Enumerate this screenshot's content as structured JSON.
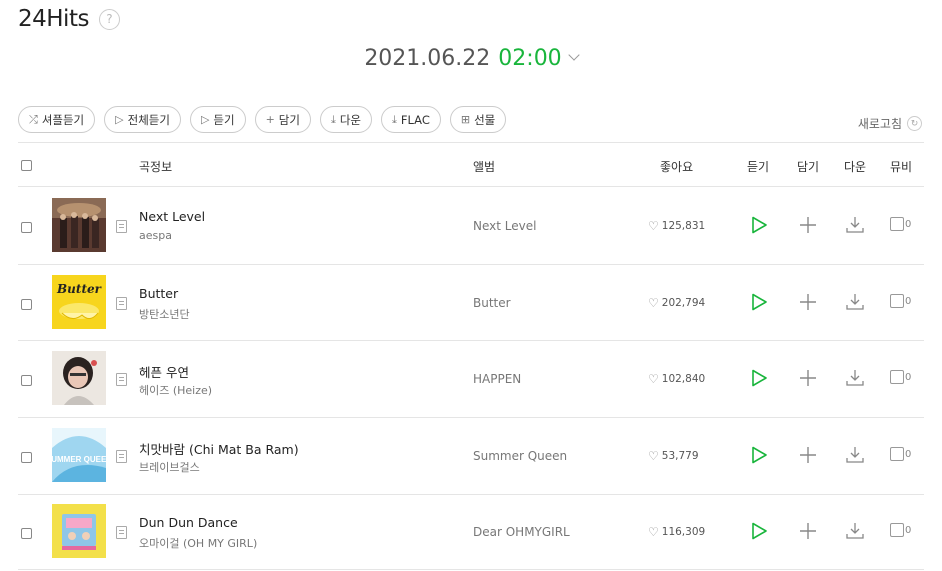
{
  "header": {
    "title": "24Hits",
    "help_label": "?"
  },
  "datetime": {
    "date": "2021.06.22",
    "time": "02:00"
  },
  "toolbar": {
    "buttons": [
      {
        "icon": "shuffle-icon",
        "glyph": "⤮",
        "label": "셔플듣기"
      },
      {
        "icon": "play-icon",
        "glyph": "▷",
        "label": "전체듣기"
      },
      {
        "icon": "play-icon",
        "glyph": "▷",
        "label": "듣기"
      },
      {
        "icon": "plus-icon",
        "glyph": "+",
        "label": "담기"
      },
      {
        "icon": "download-icon",
        "glyph": "⤓",
        "label": "다운"
      },
      {
        "icon": "download-icon",
        "glyph": "⤓",
        "label": "FLAC"
      },
      {
        "icon": "gift-icon",
        "glyph": "⊞",
        "label": "선물"
      }
    ]
  },
  "refresh": {
    "label": "새로고침"
  },
  "table": {
    "columns": {
      "song_info": "곡정보",
      "album": "앨범",
      "likes": "좋아요",
      "listen": "듣기",
      "add": "담기",
      "download": "다운",
      "mv": "뮤비"
    },
    "rows": [
      {
        "title": "Next Level",
        "artist": "aespa",
        "album": "Next Level",
        "likes": "125,831",
        "mv_count": "0"
      },
      {
        "title": "Butter",
        "artist": "방탄소년단",
        "album": "Butter",
        "likes": "202,794",
        "mv_count": "0",
        "cover_text": "Butter"
      },
      {
        "title": "헤픈 우연",
        "artist": "헤이즈 (Heize)",
        "album": "HAPPEN",
        "likes": "102,840",
        "mv_count": "0"
      },
      {
        "title": "치맛바람 (Chi Mat Ba Ram)",
        "artist": "브레이브걸스",
        "album": "Summer Queen",
        "likes": "53,779",
        "mv_count": "0",
        "cover_text": "SUMMER QUEEN"
      },
      {
        "title": "Dun Dun Dance",
        "artist": "오마이걸 (OH MY GIRL)",
        "album": "Dear OHMYGIRL",
        "likes": "116,309",
        "mv_count": "0"
      }
    ]
  },
  "colors": {
    "accent_green": "#19b53c",
    "border": "#e5e5e5"
  }
}
